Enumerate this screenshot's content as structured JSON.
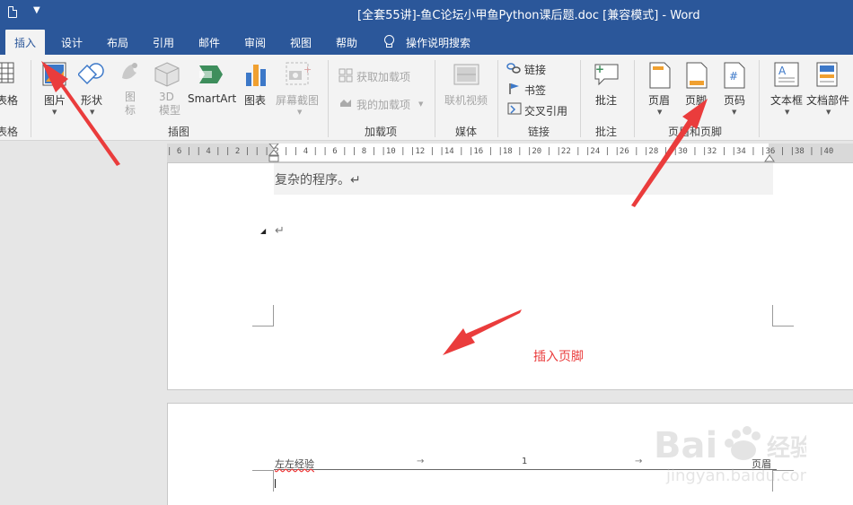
{
  "window": {
    "title": "[全套55讲]-鱼C论坛小甲鱼Python课后题.doc [兼容模式]  -  Word"
  },
  "tabs": [
    {
      "label": "插入"
    },
    {
      "label": "设计"
    },
    {
      "label": "布局"
    },
    {
      "label": "引用"
    },
    {
      "label": "邮件"
    },
    {
      "label": "审阅"
    },
    {
      "label": "视图"
    },
    {
      "label": "帮助"
    }
  ],
  "search": {
    "label": "操作说明搜索"
  },
  "ribbon": {
    "table_partial_label": "表格",
    "table_partial_group": "表格",
    "illustrations": {
      "picture": "图片",
      "shapes": "形状",
      "icons": "图\n标",
      "model3d": "3D\n模型",
      "smartart": "SmartArt",
      "chart": "图表",
      "screenshot": "屏幕截图",
      "group": "插图"
    },
    "addins": {
      "get": "获取加载项",
      "my": "我的加载项",
      "group": "加载项"
    },
    "media": {
      "online_video": "联机视频",
      "group": "媒体"
    },
    "links": {
      "link": "链接",
      "bookmark": "书签",
      "cross_ref": "交叉引用",
      "group": "链接"
    },
    "comments": {
      "comment": "批注",
      "group": "批注"
    },
    "header_footer": {
      "header": "页眉",
      "footer": "页脚",
      "page_number": "页码",
      "group": "页眉和页脚"
    },
    "text": {
      "textbox": "文本框",
      "doc_parts": "文档部件"
    }
  },
  "ruler": {
    "marks": "| 6 |   | 4 |   | 2 |   |   | 2 |   | 4 |   | 6 |   | 8 |   |10 |   |12 |   |14 |   |16 |   |18 |   |20 |   |22 |   |24 |   |26 |   |28 |   |30 |   |32 |   |34 |   |36 |   |38 |   |40"
  },
  "document": {
    "line1": "复杂的程序。↵",
    "para_mark": "↵",
    "annotation": "插入页脚",
    "header_left": "左左经验",
    "header_center": "1",
    "header_right": "页眉",
    "tab_mark": "→"
  },
  "colors": {
    "brand": "#2b579a",
    "annotation": "#ea3c3c"
  }
}
